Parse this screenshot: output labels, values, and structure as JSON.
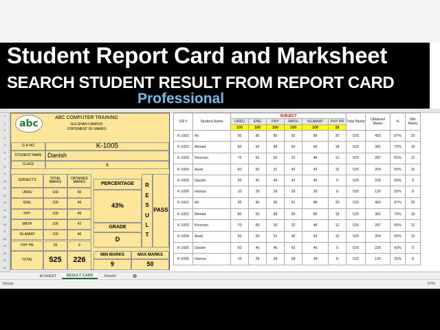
{
  "title": {
    "main": "Student Report Card and Marksheet",
    "sub": "SEARCH STUDENT RESULT FROM REPORT CARD",
    "pro": "Professional"
  },
  "card": {
    "school": "ABC COMPUTER TRAINING",
    "campus": "GULSHAN CAMPUS",
    "statement": "STATEMENT OF MARKS",
    "gr_label": "G R NO",
    "gr_value": "K-1005",
    "name_label": "STUDENT NAME",
    "name_value": "Danish",
    "class_label": "CLASS",
    "class_value": "x",
    "hdr_subjects": "SUBJECTS",
    "hdr_total": "TOTAL MARKS",
    "hdr_obtained": "OBTAINED MARKS",
    "subjects": [
      {
        "name": "URDU",
        "total": "100",
        "obtained": "50"
      },
      {
        "name": "ENG",
        "total": "100",
        "obtained": "45"
      },
      {
        "name": "PHY",
        "total": "100",
        "obtained": "40"
      },
      {
        "name": "MATH",
        "total": "100",
        "obtained": "42"
      },
      {
        "name": "ISLAMIAT",
        "total": "100",
        "obtained": "40"
      },
      {
        "name": "PHY PR",
        "total": "25",
        "obtained": "9"
      }
    ],
    "total_label": "TOTAL",
    "total_marks": "525",
    "total_obtained": "226",
    "percentage_label": "PERCENTAGE",
    "percentage_value": "43%",
    "grade_label": "GRADE",
    "grade_value": "D",
    "result_letters": [
      "R",
      "E",
      "S",
      "U",
      "L",
      "T"
    ],
    "result_value": "PASS",
    "min_label": "MIN MARKS",
    "min_value": "9",
    "max_label": "MAX MARKS",
    "max_value": "50"
  },
  "table": {
    "headers": {
      "gr": "GR #",
      "name": "Student Name",
      "subject": "SUBJECT",
      "subjects": [
        "URDU",
        "ENG",
        "PHY",
        "MATH",
        "ISLAMIAT",
        "PHY PR"
      ],
      "total": "Total Marks",
      "obtained": "Obtained Marks",
      "pct": "%",
      "min": "Min Marks"
    },
    "max_row": [
      "100",
      "100",
      "100",
      "100",
      "100",
      "25"
    ],
    "rows": [
      [
        "K-1001",
        "Ali",
        "90",
        "85",
        "80",
        "92",
        "88",
        "20",
        "525",
        "455",
        "87%",
        "20"
      ],
      [
        "K-1002",
        "Ahmed",
        "80",
        "65",
        "88",
        "50",
        "80",
        "18",
        "525",
        "381",
        "73%",
        "18"
      ],
      [
        "K-1003",
        "Khurram",
        "70",
        "65",
        "60",
        "32",
        "48",
        "12",
        "525",
        "287",
        "55%",
        "12"
      ],
      [
        "K-1004",
        "Asad",
        "60",
        "55",
        "51",
        "40",
        "43",
        "15",
        "525",
        "264",
        "50%",
        "15"
      ],
      [
        "K-1005",
        "Danish",
        "50",
        "45",
        "40",
        "42",
        "40",
        "9",
        "525",
        "226",
        "43%",
        "9"
      ],
      [
        "K-1006",
        "Hamza",
        "10",
        "28",
        "28",
        "28",
        "28",
        "8",
        "525",
        "130",
        "25%",
        "8"
      ],
      [
        "K-1001",
        "Ali",
        "90",
        "85",
        "80",
        "92",
        "88",
        "20",
        "525",
        "455",
        "87%",
        "20"
      ],
      [
        "K-1002",
        "Ahmed",
        "80",
        "65",
        "88",
        "50",
        "80",
        "18",
        "525",
        "381",
        "73%",
        "18"
      ],
      [
        "K-1003",
        "Khurram",
        "70",
        "65",
        "60",
        "32",
        "48",
        "12",
        "525",
        "287",
        "55%",
        "12"
      ],
      [
        "K-1004",
        "Asad",
        "60",
        "55",
        "51",
        "40",
        "43",
        "15",
        "525",
        "264",
        "50%",
        "15"
      ],
      [
        "K-1005",
        "Danish",
        "50",
        "45",
        "40",
        "42",
        "40",
        "9",
        "525",
        "226",
        "43%",
        "9"
      ],
      [
        "K-1006",
        "Hamza",
        "10",
        "28",
        "28",
        "28",
        "28",
        "8",
        "525",
        "130",
        "25%",
        "8"
      ]
    ]
  },
  "tabs": [
    "M-SHEET",
    "RESULT CARD",
    "Sheet3"
  ],
  "status": {
    "ready": "Ready",
    "zoom": "67%"
  }
}
